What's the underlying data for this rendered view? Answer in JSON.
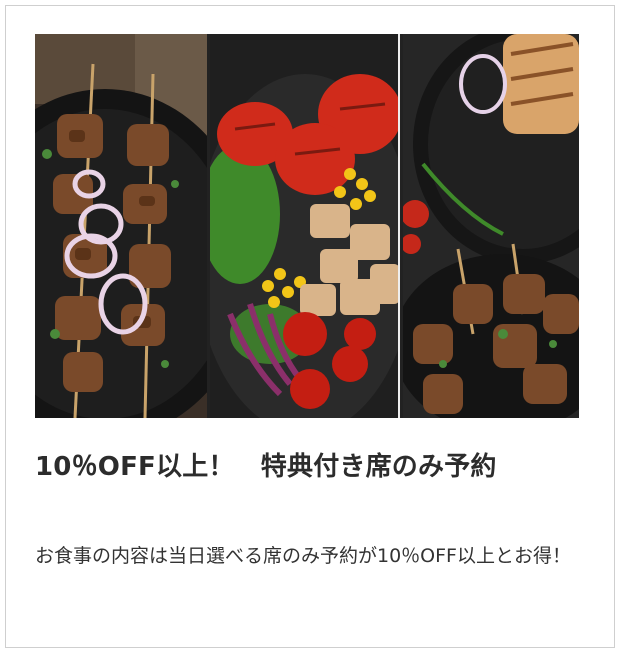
{
  "promo": {
    "title": "10％OFF以上！　特典付き席のみ予約",
    "description": "お食事の内容は当日選べる席のみ予約が10％OFF以上とお得！"
  },
  "banner": {
    "panels": [
      {
        "name": "kebab-skewers-on-black-plate"
      },
      {
        "name": "salad-with-grilled-peppers-and-chicken"
      },
      {
        "name": "grilled-meat-and-skewers"
      }
    ]
  }
}
